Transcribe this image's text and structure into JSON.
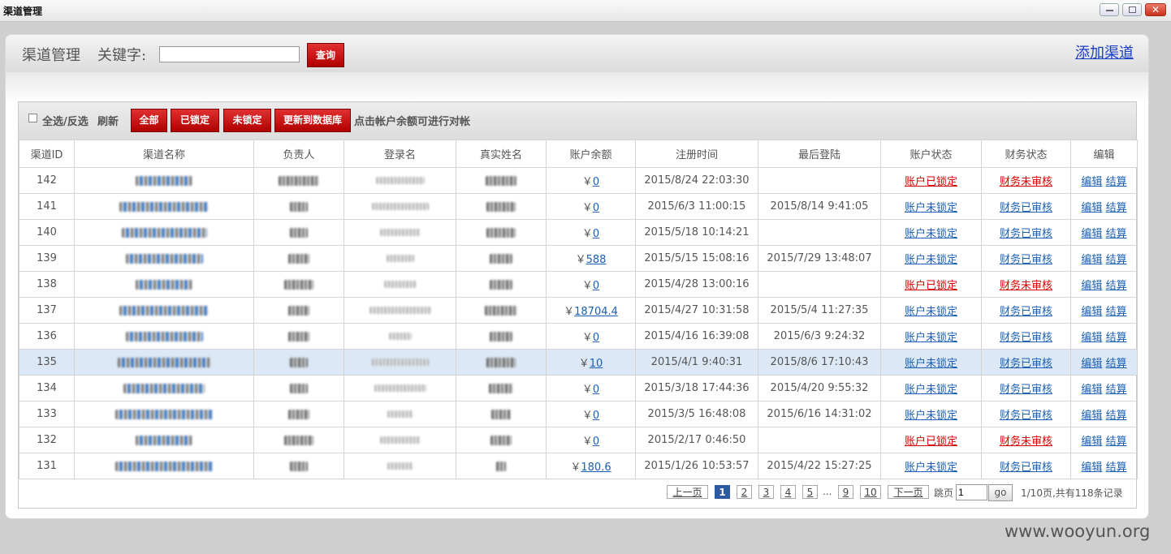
{
  "window": {
    "title": "渠道管理",
    "close_glyph": "✕"
  },
  "header": {
    "page_title": "渠道管理",
    "keyword_label": "关键字:",
    "search_value": "",
    "search_button": "查询",
    "add_link": "添加渠道"
  },
  "toolbar": {
    "select_all_label": "全选/反选",
    "refresh_label": "刷新",
    "btn_all": "全部",
    "btn_locked": "已锁定",
    "btn_unlocked": "未锁定",
    "btn_update_db": "更新到数据库",
    "hint": "点击帐户余额可进行对帐"
  },
  "table": {
    "columns": [
      "渠道ID",
      "渠道名称",
      "负责人",
      "登录名",
      "真实姓名",
      "账户余额",
      "注册时间",
      "最后登陆",
      "账户状态",
      "财务状态",
      "编辑"
    ],
    "currency_symbol": "￥",
    "edit_label": "编辑",
    "settle_label": "结算",
    "rows": [
      {
        "id": "142",
        "balance": "0",
        "reg": "2015/8/24 22:03:30",
        "last": "",
        "acct": "账户已锁定",
        "acct_red": true,
        "fin": "财务未审核",
        "fin_red": true
      },
      {
        "id": "141",
        "balance": "0",
        "reg": "2015/6/3 11:00:15",
        "last": "2015/8/14 9:41:05",
        "acct": "账户未锁定",
        "acct_red": false,
        "fin": "财务已审核",
        "fin_red": false
      },
      {
        "id": "140",
        "balance": "0",
        "reg": "2015/5/18 10:14:21",
        "last": "",
        "acct": "账户未锁定",
        "acct_red": false,
        "fin": "财务已审核",
        "fin_red": false
      },
      {
        "id": "139",
        "balance": "588",
        "reg": "2015/5/15 15:08:16",
        "last": "2015/7/29 13:48:07",
        "acct": "账户未锁定",
        "acct_red": false,
        "fin": "财务已审核",
        "fin_red": false
      },
      {
        "id": "138",
        "balance": "0",
        "reg": "2015/4/28 13:00:16",
        "last": "",
        "acct": "账户已锁定",
        "acct_red": true,
        "fin": "财务未审核",
        "fin_red": true
      },
      {
        "id": "137",
        "balance": "18704.4",
        "reg": "2015/4/27 10:31:58",
        "last": "2015/5/4 11:27:35",
        "acct": "账户未锁定",
        "acct_red": false,
        "fin": "财务已审核",
        "fin_red": false
      },
      {
        "id": "136",
        "balance": "0",
        "reg": "2015/4/16 16:39:08",
        "last": "2015/6/3 9:24:32",
        "acct": "账户未锁定",
        "acct_red": false,
        "fin": "财务已审核",
        "fin_red": false
      },
      {
        "id": "135",
        "balance": "10",
        "reg": "2015/4/1 9:40:31",
        "last": "2015/8/6 17:10:43",
        "acct": "账户未锁定",
        "acct_red": false,
        "fin": "财务已审核",
        "fin_red": false
      },
      {
        "id": "134",
        "balance": "0",
        "reg": "2015/3/18 17:44:36",
        "last": "2015/4/20 9:55:32",
        "acct": "账户未锁定",
        "acct_red": false,
        "fin": "财务已审核",
        "fin_red": false
      },
      {
        "id": "133",
        "balance": "0",
        "reg": "2015/3/5 16:48:08",
        "last": "2015/6/16 14:31:02",
        "acct": "账户未锁定",
        "acct_red": false,
        "fin": "财务已审核",
        "fin_red": false
      },
      {
        "id": "132",
        "balance": "0",
        "reg": "2015/2/17 0:46:50",
        "last": "",
        "acct": "账户已锁定",
        "acct_red": true,
        "fin": "财务未审核",
        "fin_red": true
      },
      {
        "id": "131",
        "balance": "180.6",
        "reg": "2015/1/26 10:53:57",
        "last": "2015/4/22 15:27:25",
        "acct": "账户未锁定",
        "acct_red": false,
        "fin": "财务已审核",
        "fin_red": false
      }
    ]
  },
  "pager": {
    "prev": "上一页",
    "pages": [
      "1",
      "2",
      "3",
      "4",
      "5"
    ],
    "ellipsis": "...",
    "tail_pages": [
      "9",
      "10"
    ],
    "next": "下一页",
    "jump_label": "跳页",
    "jump_value": "1",
    "go": "go",
    "summary": "1/10页,共有118条记录"
  },
  "watermark": "www.wooyun.org"
}
